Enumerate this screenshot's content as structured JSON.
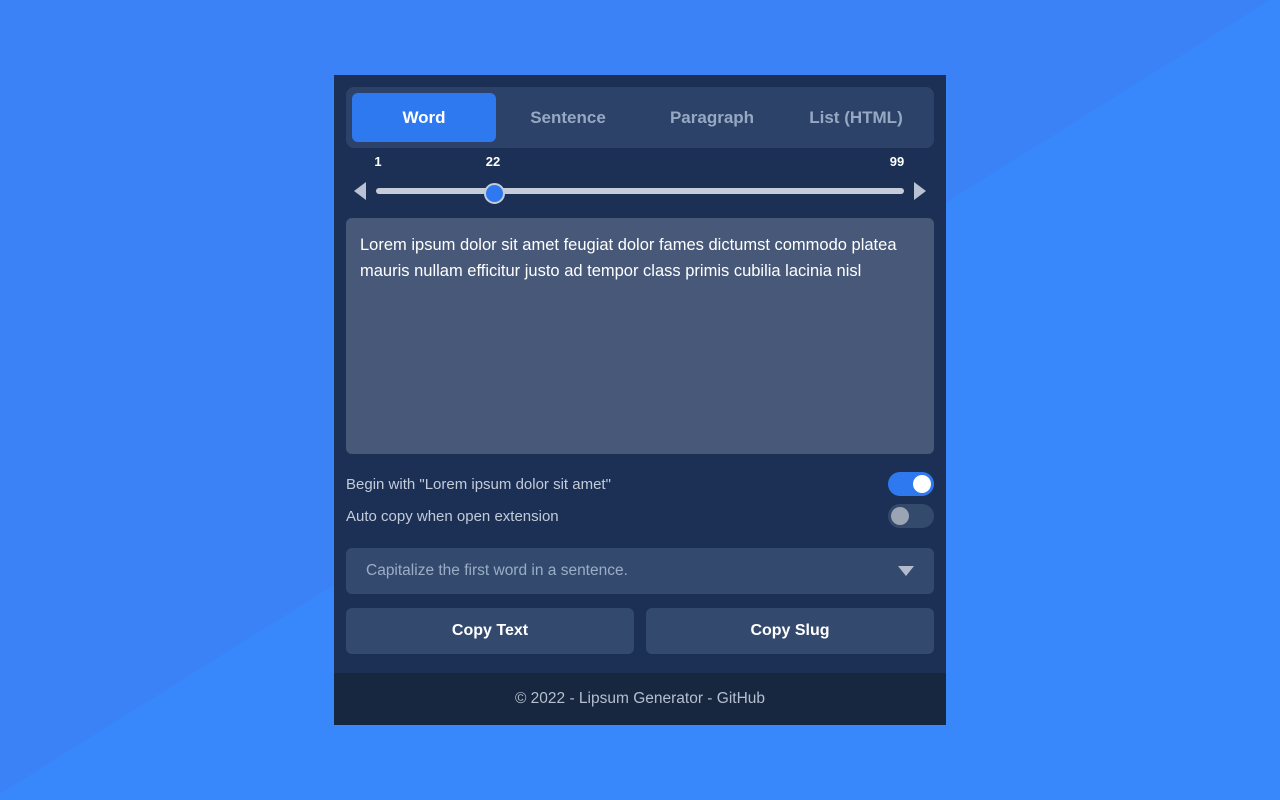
{
  "background": {
    "color_light": "#3887fb",
    "color_dark": "#3b82f6"
  },
  "theme": {
    "panel_bg": "#1b3054",
    "tabbar_bg": "#2c4268",
    "accent": "#2f79f0",
    "field_bg": "#334a6e",
    "output_bg": "#475878",
    "footer_bg": "#16273f"
  },
  "tabs": [
    {
      "label": "Word",
      "active": true
    },
    {
      "label": "Sentence",
      "active": false
    },
    {
      "label": "Paragraph",
      "active": false
    },
    {
      "label": "List (HTML)",
      "active": false
    }
  ],
  "slider": {
    "min_label": "1",
    "value_label": "22",
    "max_label": "99",
    "min": 1,
    "max": 99,
    "value": 22,
    "decrement_icon": "triangle-left-icon",
    "increment_icon": "triangle-right-icon"
  },
  "output": {
    "text": "Lorem ipsum dolor sit amet feugiat dolor fames dictumst commodo platea mauris nullam efficitur justo ad tempor class primis cubilia lacinia nisl"
  },
  "options": [
    {
      "label": "Begin with \"Lorem ipsum dolor sit amet\"",
      "state": "on"
    },
    {
      "label": "Auto copy when open extension",
      "state": "off"
    }
  ],
  "select": {
    "value": "Capitalize the first word in a sentence.",
    "caret_icon": "chevron-down-icon"
  },
  "actions": {
    "copy_text_label": "Copy Text",
    "copy_slug_label": "Copy Slug"
  },
  "footer": {
    "prefix": "© 2022 - Lipsum Generator - ",
    "link": "GitHub"
  }
}
